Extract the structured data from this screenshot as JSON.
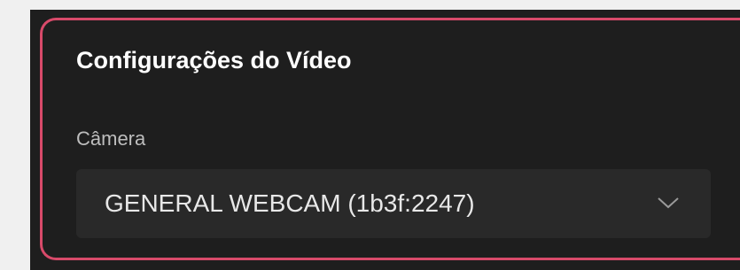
{
  "video_settings": {
    "title": "Configurações do Vídeo",
    "camera_label": "Câmera",
    "camera_select": {
      "selected_value": "GENERAL WEBCAM (1b3f:2247)",
      "icon": "chevron-down-icon"
    },
    "highlight_color": "#d84a6a"
  }
}
